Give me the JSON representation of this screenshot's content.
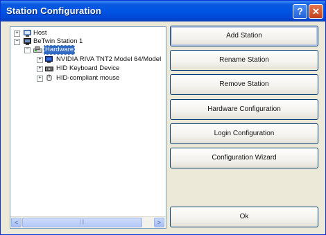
{
  "window": {
    "title": "Station Configuration",
    "help_glyph": "?",
    "close_glyph": "✕"
  },
  "tree": {
    "nodes": [
      {
        "label": "Host",
        "expander": "+",
        "icon": "computer-icon"
      },
      {
        "label": "BeTwin Station 1",
        "expander": "−",
        "icon": "computer-icon"
      },
      {
        "label": "Hardware",
        "expander": "−",
        "icon": "hardware-icon",
        "selected": true
      },
      {
        "label": "NVIDIA RIVA TNT2 Model 64/Model",
        "expander": "+",
        "icon": "monitor-icon"
      },
      {
        "label": "HID Keyboard Device",
        "expander": "+",
        "icon": "keyboard-icon"
      },
      {
        "label": "HID-compliant mouse",
        "expander": "+",
        "icon": "mouse-icon"
      }
    ],
    "scroll_left": "<",
    "scroll_right": ">",
    "scroll_grip": "|||"
  },
  "buttons": {
    "add_station": "Add Station",
    "rename_station": "Rename Station",
    "remove_station": "Remove Station",
    "hardware_configuration": "Hardware Configuration",
    "login_configuration": "Login Configuration",
    "configuration_wizard": "Configuration Wizard",
    "ok": "Ok"
  }
}
